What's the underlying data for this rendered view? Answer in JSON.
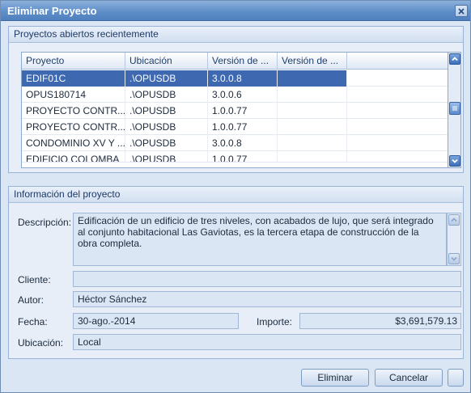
{
  "window": {
    "title": "Eliminar Proyecto"
  },
  "recent": {
    "header": "Proyectos abiertos recientemente",
    "columns": [
      "Proyecto",
      "Ubicación",
      "Versión de ...",
      "Versión de ..."
    ],
    "rows": [
      [
        "EDIF01C",
        ".\\OPUSDB",
        "3.0.0.8",
        ""
      ],
      [
        "OPUS180714",
        ".\\OPUSDB",
        "3.0.0.6",
        ""
      ],
      [
        "PROYECTO CONTR...",
        ".\\OPUSDB",
        "1.0.0.77",
        ""
      ],
      [
        "PROYECTO CONTR...",
        ".\\OPUSDB",
        "1.0.0.77",
        ""
      ],
      [
        "CONDOMINIO XV Y ...",
        ".\\OPUSDB",
        "3.0.0.8",
        ""
      ],
      [
        "EDIFICIO COLOMBA",
        ".\\OPUSDB",
        "1.0.0.77",
        ""
      ]
    ],
    "selected_row": 0
  },
  "info": {
    "header": "Información del proyecto",
    "description_label": "Descripción:",
    "description": "Edificación de un edificio de tres niveles, con acabados de lujo, que será integrado al conjunto habitacional Las Gaviotas, es la tercera etapa de construcción de la obra completa.",
    "client_label": "Cliente:",
    "client": "",
    "author_label": "Autor:",
    "author": "Héctor Sánchez",
    "date_label": "Fecha:",
    "date": "30-ago.-2014",
    "amount_label": "Importe:",
    "amount": "$3,691,579.13",
    "location_label": "Ubicación:",
    "location": "Local"
  },
  "buttons": {
    "delete": "Eliminar",
    "cancel": "Cancelar"
  },
  "colors": {
    "selection": "#3e68b0",
    "title_bar": "#5f8fc9"
  }
}
